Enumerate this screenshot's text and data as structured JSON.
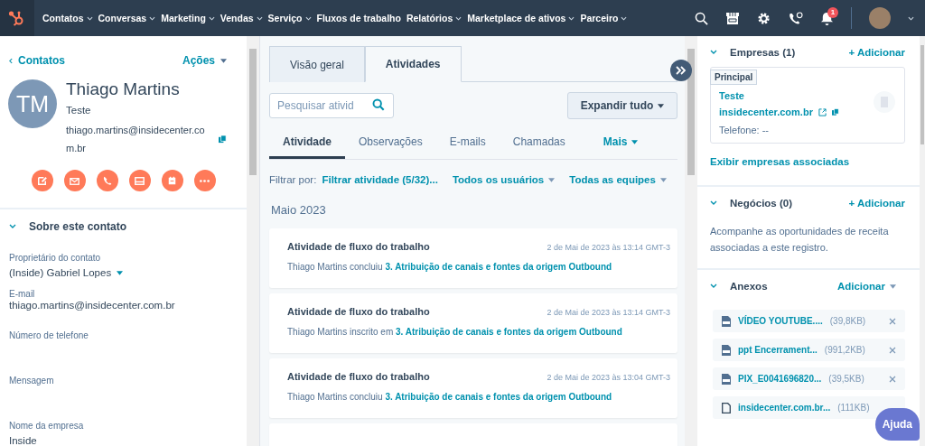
{
  "nav": {
    "items": [
      {
        "label": "Contatos",
        "dropdown": true
      },
      {
        "label": "Conversas",
        "dropdown": true
      },
      {
        "label": "Marketing",
        "dropdown": true
      },
      {
        "label": "Vendas",
        "dropdown": true
      },
      {
        "label": "Serviço",
        "dropdown": true
      },
      {
        "label": "Fluxos de trabalho",
        "dropdown": false
      },
      {
        "label": "Relatórios",
        "dropdown": true
      },
      {
        "label": "Marketplace de ativos",
        "dropdown": true
      },
      {
        "label": "Parceiro",
        "dropdown": true
      }
    ],
    "notification_count": "1"
  },
  "contact": {
    "back_link": "Contatos",
    "actions": "Ações",
    "initials": "TM",
    "name": "Thiago Martins",
    "title": "Teste",
    "email": "thiago.martins@insidecenter.com.br",
    "action_buttons": [
      {
        "kind": "note"
      },
      {
        "kind": "email"
      },
      {
        "kind": "call"
      },
      {
        "kind": "task"
      },
      {
        "kind": "meeting"
      },
      {
        "kind": "more"
      }
    ]
  },
  "about": {
    "title": "Sobre este contato",
    "expanded": true,
    "fields": [
      {
        "label": "Proprietário do contato",
        "value": "(Inside) Gabriel Lopes",
        "kind": "dropdown"
      },
      {
        "label": "E-mail",
        "value": "thiago.martins@insidecenter.com.br",
        "kind": "text"
      },
      {
        "label": "Número de telefone",
        "kind": "text"
      },
      {
        "label": "Mensagem",
        "kind": "text"
      },
      {
        "label": "Nome da empresa",
        "value": "Inside",
        "kind": "text"
      }
    ]
  },
  "activity": {
    "tabs": [
      {
        "label": "Visão geral",
        "selected": false
      },
      {
        "label": "Atividades",
        "selected": true
      }
    ],
    "search": {
      "placeholder": "Pesquisar ativid"
    },
    "expand_button": "Expandir tudo",
    "subtabs": [
      {
        "label": "Atividade",
        "selected": true,
        "kind": "tab"
      },
      {
        "label": "Observações",
        "selected": false,
        "kind": "tab"
      },
      {
        "label": "E-mails",
        "selected": false,
        "kind": "tab"
      },
      {
        "label": "Chamadas",
        "selected": false,
        "kind": "tab"
      },
      {
        "label": "Mais",
        "selected": false,
        "kind": "menu"
      }
    ],
    "filter_label": "Filtrar por:",
    "filters": [
      {
        "label": "Filtrar atividade (5/32)...",
        "dropdown": false
      },
      {
        "label": "Todos os usuários",
        "dropdown": true
      },
      {
        "label": "Todas as equipes",
        "dropdown": true
      }
    ],
    "month": "Maio 2023",
    "items": [
      {
        "title": "Atividade de fluxo do trabalho",
        "time": "2 de Mai de 2023 às 13:14 GMT-3",
        "text": "Thiago Martins concluiu",
        "link": "3. Atribuição de canais e fontes da origem Outbound"
      },
      {
        "title": "Atividade de fluxo do trabalho",
        "time": "2 de Mai de 2023 às 13:14 GMT-3",
        "text": "Thiago Martins inscrito em",
        "link": "3. Atribuição de canais e fontes da origem Outbound"
      },
      {
        "title": "Atividade de fluxo do trabalho",
        "time": "2 de Mai de 2023 às 13:04 GMT-3",
        "text": "Thiago Martins concluiu",
        "link": "3. Atribuição de canais e fontes da origem Outbound"
      }
    ]
  },
  "sidebar": {
    "companies": {
      "title": "Empresas (1)",
      "add": "+ Adicionar",
      "expanded": true,
      "cards": [
        {
          "badge": "Principal",
          "name": "Teste",
          "domain": "insidecenter.com.br",
          "phone": "Telefone: --"
        }
      ],
      "view_all": "Exibir empresas associadas"
    },
    "deals": {
      "title": "Negócios (0)",
      "add": "+ Adicionar",
      "expanded": true,
      "description": "Acompanhe as oportunidades de receita associadas a este registro."
    },
    "attachments": {
      "title": "Anexos",
      "add": "Adicionar",
      "expanded": true,
      "files": [
        {
          "name": "VÍDEO YOUTUBE....",
          "size": "(39,8KB)",
          "kind": "pdf",
          "removable": true
        },
        {
          "name": "ppt Encerrament...",
          "size": "(991,2KB)",
          "kind": "pdf",
          "removable": true
        },
        {
          "name": "PIX_E0041696820...",
          "size": "(39,5KB)",
          "kind": "pdf",
          "removable": true
        },
        {
          "name": "insidecenter.com.br...",
          "size": "(111KB)",
          "kind": "file",
          "removable": false
        }
      ]
    }
  },
  "help_button": "Ajuda"
}
